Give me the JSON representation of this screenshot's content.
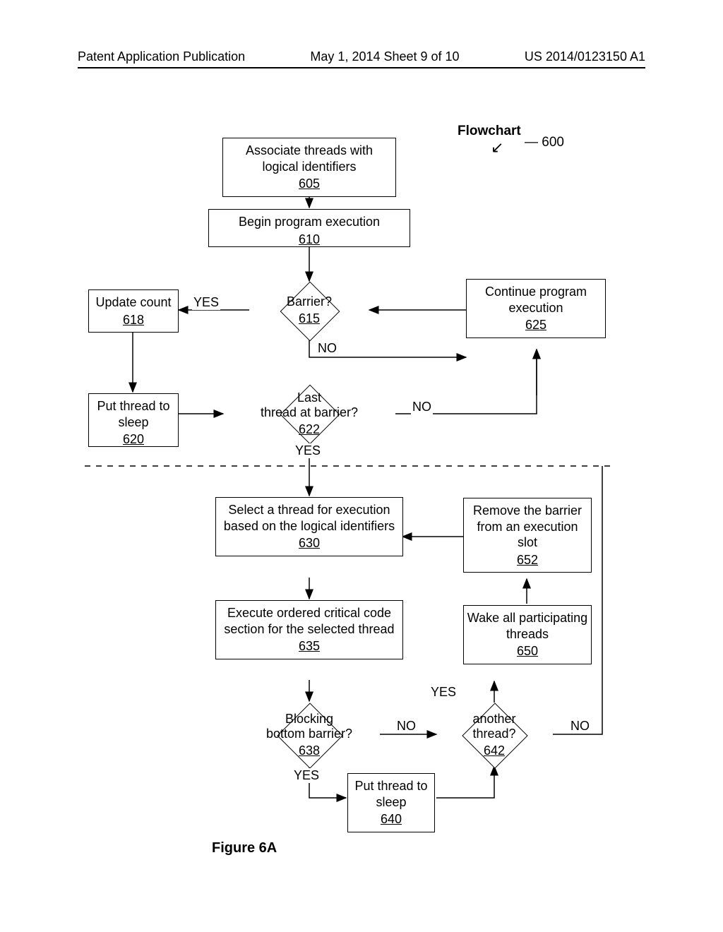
{
  "header": {
    "left": "Patent Application Publication",
    "center": "May 1, 2014  Sheet 9 of 10",
    "right": "US 2014/0123150 A1"
  },
  "flowchart": {
    "title": "Flowchart",
    "number": "600"
  },
  "nodes": {
    "n605": {
      "text": "Associate threads with logical identifiers",
      "ref": "605"
    },
    "n610": {
      "text": "Begin program execution",
      "ref": "610"
    },
    "n615": {
      "text": "Barrier?",
      "ref": "615"
    },
    "n618": {
      "text": "Update count",
      "ref": "618"
    },
    "n620": {
      "text": "Put thread to sleep",
      "ref": "620"
    },
    "n622": {
      "text": "Last thread at barrier?",
      "ref": "622"
    },
    "n625": {
      "text": "Continue program execution",
      "ref": "625"
    },
    "n630": {
      "text": "Select a thread for execution based on the logical identifiers",
      "ref": "630"
    },
    "n635": {
      "text": "Execute ordered critical code section for the selected thread",
      "ref": "635"
    },
    "n638": {
      "text": "Blocking bottom barrier?",
      "ref": "638"
    },
    "n640": {
      "text": "Put thread to sleep",
      "ref": "640"
    },
    "n642": {
      "text": "another thread?",
      "ref": "642"
    },
    "n650": {
      "text": "Wake all participating threads",
      "ref": "650"
    },
    "n652": {
      "text": "Remove the barrier from an execution slot",
      "ref": "652"
    }
  },
  "labels": {
    "yes": "YES",
    "no": "NO"
  },
  "caption": "Figure 6A"
}
